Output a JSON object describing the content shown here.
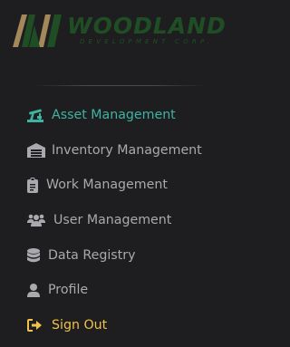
{
  "brand": {
    "name": "WOODLAND",
    "subtitle": "DEVELOPMENT CORP.",
    "color": "#1f4e24",
    "accent": "#a3895a"
  },
  "nav": {
    "items": [
      {
        "label": "Asset Management",
        "icon": "pumpjack-icon",
        "state": "active",
        "color": "#3fb3a1"
      },
      {
        "label": "Inventory Management",
        "icon": "warehouse-icon",
        "state": "default",
        "color": "#a9a9ae"
      },
      {
        "label": "Work Management",
        "icon": "clipboard-icon",
        "state": "default",
        "color": "#a9a9ae"
      },
      {
        "label": "User Management",
        "icon": "users-icon",
        "state": "default",
        "color": "#a9a9ae"
      },
      {
        "label": "Data Registry",
        "icon": "database-icon",
        "state": "default",
        "color": "#a9a9ae"
      },
      {
        "label": "Profile",
        "icon": "user-icon",
        "state": "default",
        "color": "#a9a9ae"
      },
      {
        "label": "Sign Out",
        "icon": "sign-out-icon",
        "state": "default",
        "color": "#f0c24a"
      }
    ]
  }
}
